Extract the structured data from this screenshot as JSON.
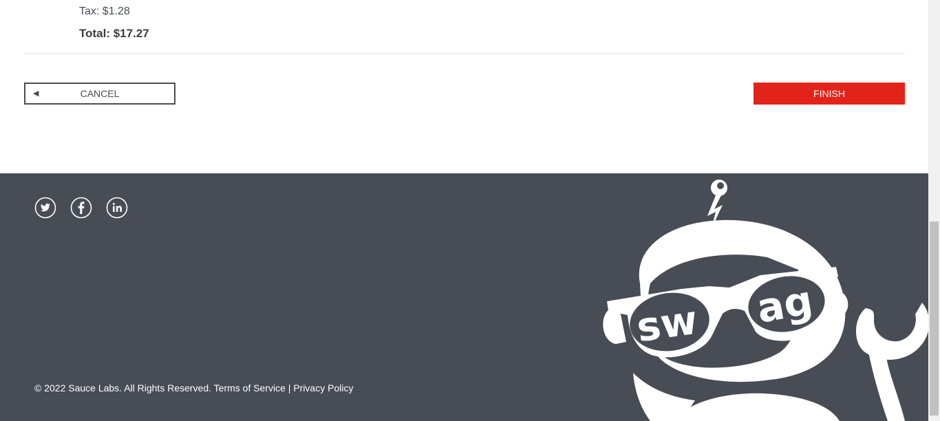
{
  "summary": {
    "tax": "Tax: $1.28",
    "total": "Total: $17.27"
  },
  "actions": {
    "cancel_label": "CANCEL",
    "cancel_icon": "◀",
    "finish_label": "FINISH"
  },
  "footer": {
    "social": [
      "twitter-icon",
      "facebook-icon",
      "linkedin-icon"
    ],
    "copyright": "© 2022 Sauce Labs. All Rights Reserved. Terms of Service | Privacy Policy",
    "mascot_text": "swag"
  },
  "colors": {
    "accent": "#e2231a",
    "footer_bg": "#474c55",
    "text": "#484c55"
  }
}
